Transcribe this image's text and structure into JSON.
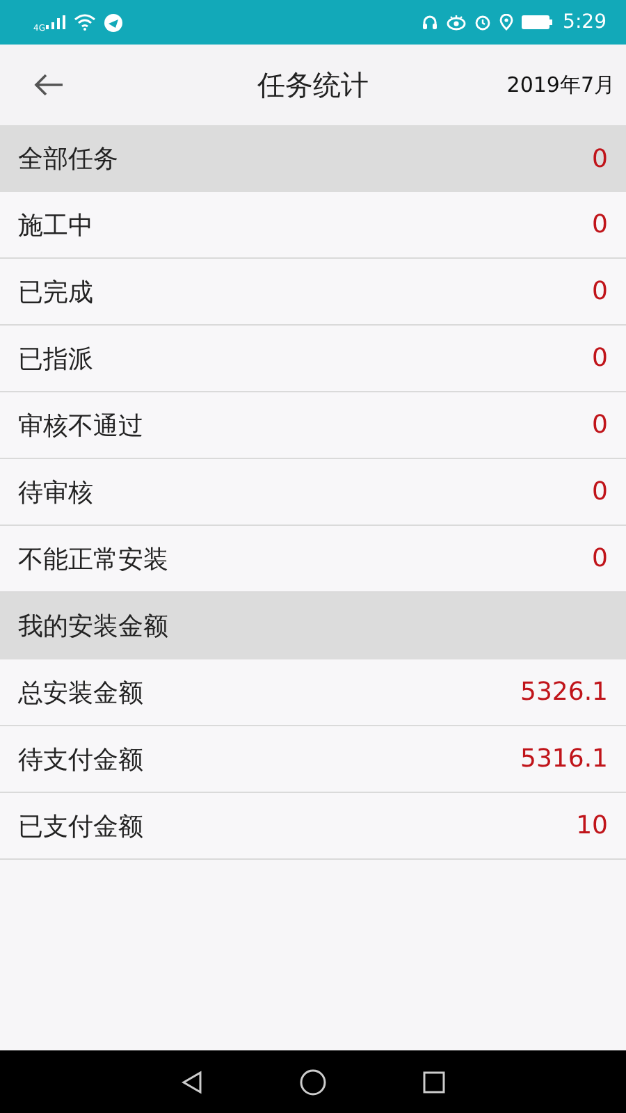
{
  "status_bar": {
    "network": "4G",
    "time": "5:29"
  },
  "header": {
    "title": "任务统计",
    "date": "2019年7月"
  },
  "sections": [
    {
      "label": "全部任务",
      "value": "0",
      "rows": [
        {
          "label": "施工中",
          "value": "0"
        },
        {
          "label": "已完成",
          "value": "0"
        },
        {
          "label": "已指派",
          "value": "0"
        },
        {
          "label": "审核不通过",
          "value": "0"
        },
        {
          "label": "待审核",
          "value": "0"
        },
        {
          "label": "不能正常安装",
          "value": "0"
        }
      ]
    },
    {
      "label": "我的安装金额",
      "rows": [
        {
          "label": "总安装金额",
          "value": "5326.1"
        },
        {
          "label": "待支付金额",
          "value": "5316.1"
        },
        {
          "label": "已支付金额",
          "value": "10"
        }
      ]
    }
  ]
}
